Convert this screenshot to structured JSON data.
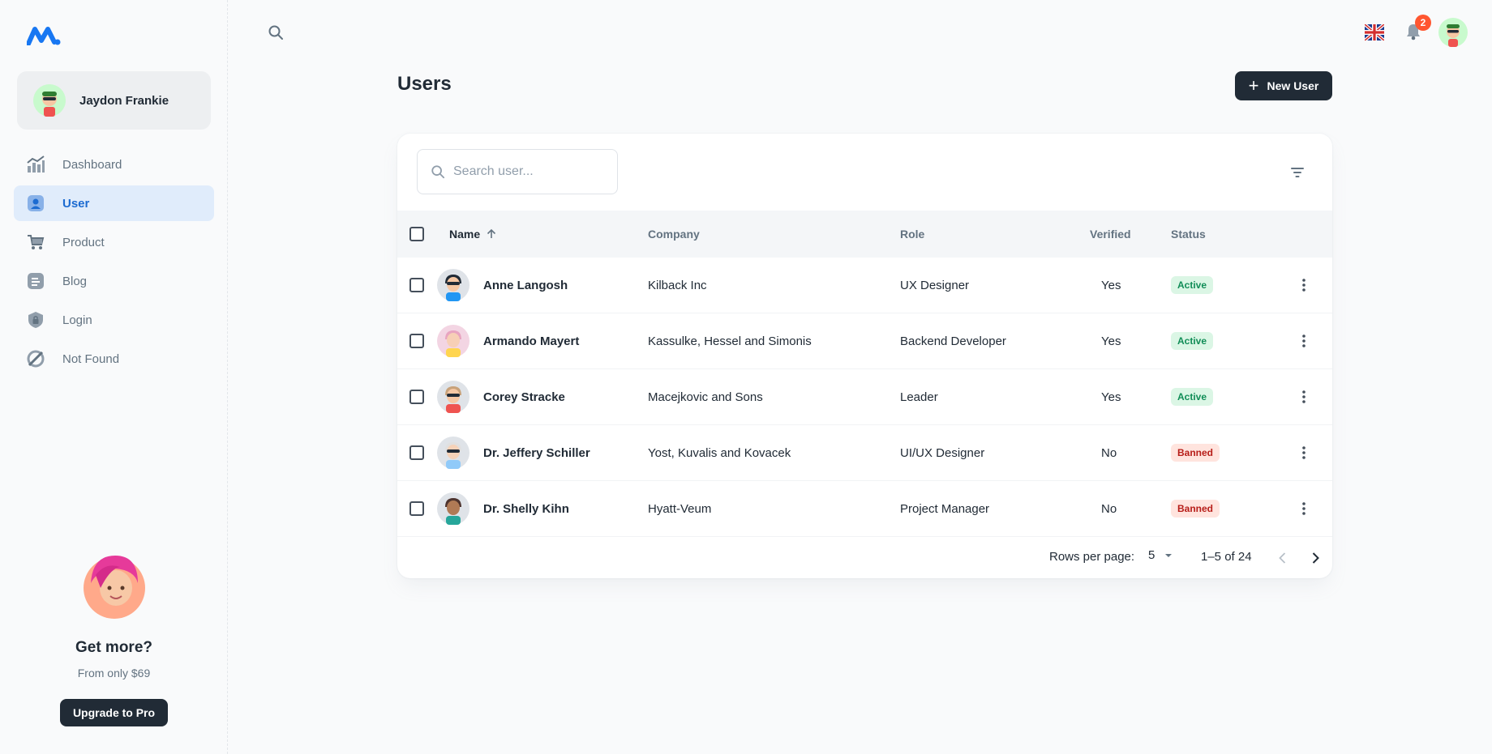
{
  "account": {
    "name": "Jaydon Frankie"
  },
  "nav": [
    {
      "label": "Dashboard",
      "icon": "analytics-icon"
    },
    {
      "label": "User",
      "icon": "user-icon",
      "active": true
    },
    {
      "label": "Product",
      "icon": "cart-icon"
    },
    {
      "label": "Blog",
      "icon": "blog-icon"
    },
    {
      "label": "Login",
      "icon": "lock-icon"
    },
    {
      "label": "Not Found",
      "icon": "disabled-icon"
    }
  ],
  "promo": {
    "title": "Get more?",
    "subtitle": "From only $69",
    "button": "Upgrade to Pro"
  },
  "topbar": {
    "notifications": "2"
  },
  "page": {
    "title": "Users",
    "new_button": "New User"
  },
  "search": {
    "placeholder": "Search user..."
  },
  "table": {
    "headers": {
      "name": "Name",
      "company": "Company",
      "role": "Role",
      "verified": "Verified",
      "status": "Status"
    },
    "rows": [
      {
        "name": "Anne Langosh",
        "company": "Kilback Inc",
        "role": "UX Designer",
        "verified": "Yes",
        "status": "Active"
      },
      {
        "name": "Armando Mayert",
        "company": "Kassulke, Hessel and Simonis",
        "role": "Backend Developer",
        "verified": "Yes",
        "status": "Active"
      },
      {
        "name": "Corey Stracke",
        "company": "Macejkovic and Sons",
        "role": "Leader",
        "verified": "Yes",
        "status": "Active"
      },
      {
        "name": "Dr. Jeffery Schiller",
        "company": "Yost, Kuvalis and Kovacek",
        "role": "UI/UX Designer",
        "verified": "No",
        "status": "Banned"
      },
      {
        "name": "Dr. Shelly Kihn",
        "company": "Hyatt-Veum",
        "role": "Project Manager",
        "verified": "No",
        "status": "Banned"
      }
    ]
  },
  "pagination": {
    "rows_label": "Rows per page:",
    "rows_value": "5",
    "range": "1–5 of 24"
  },
  "colors": {
    "accent": "#1c6bd1",
    "dark": "#212b36",
    "active_bg": "#dbf6e5",
    "banned_bg": "#ffe4de",
    "badge": "#ff5630"
  }
}
